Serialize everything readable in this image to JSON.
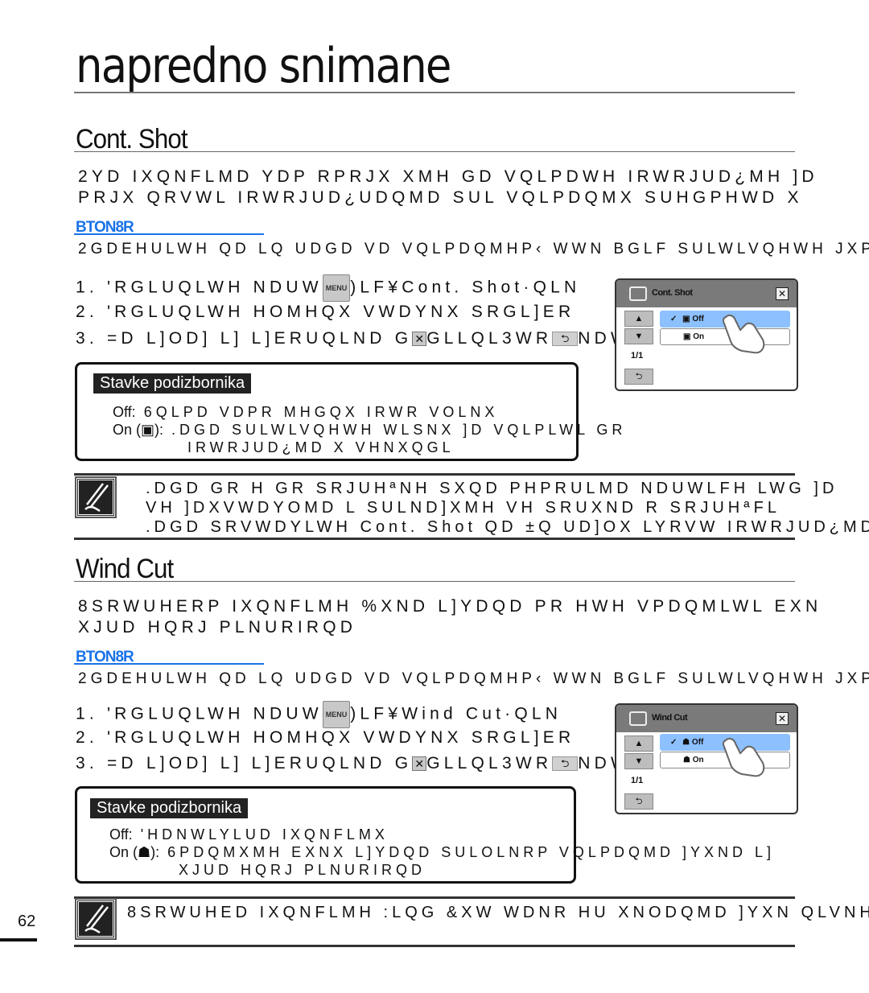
{
  "page": {
    "title": "napredno snimane",
    "number": "62"
  },
  "sections": [
    {
      "heading": "Cont. Shot",
      "intro": [
        "2YD IXQNFLMD YDP RPRJX XMH GD VQLPDWH IRWRJUD¿MH ]D",
        "PRJX QRVWL IRWRJUD¿UDQMD SUL VQLPDQMX SUHGPHWD X"
      ],
      "link_label": "BTON8R",
      "precondition": "2GDEHULWH QD LQ UDGD VD VQLPDQMHP‹ WWN BGLF SULWLVQHWH JXP",
      "steps": [
        {
          "num": "1.",
          "pre": "'RGLUQLWH NDUW",
          "menu_chip": "MENU",
          "post": ")LF¥Cont. Shot·QLN"
        },
        {
          "num": "2.",
          "pre": "'RGLUQLWH  HOMHQX VWDYNX SRGL]ER",
          "menu_chip": "",
          "post": ""
        },
        {
          "num": "3.",
          "pre": "=D L]OD] L] L]ERUQLND G",
          "x_chip": "✕",
          "mid": "GLLQL3WR",
          "back_chip": "⮌",
          "post": "NDW"
        }
      ],
      "screen": {
        "title": "Cont. Shot",
        "page_indicator": "1/1",
        "options": [
          {
            "label": "Off",
            "selected": true,
            "check": "✓"
          },
          {
            "label": "On",
            "selected": false,
            "check": ""
          }
        ],
        "up_label": "▲",
        "down_label": "▼",
        "back_label": "⮌",
        "close_label": "✕"
      },
      "submenu": {
        "title": "Stavke podizbornika",
        "items": [
          {
            "label": "Off:",
            "icon": "",
            "lines": [
              "6QLPD VDPR MHGQX IRWR VOLNX"
            ]
          },
          {
            "label": "On (",
            "icon": "▣",
            "label_end": "):",
            "lines": [
              ".DGD SULWLVQHWH WLSNX ]D VQLPLWL GR",
              "IRWRJUD¿MD X   VHNXQGL"
            ]
          }
        ]
      },
      "note": [
        ".DGD GR H GR SRJUHªNH  SXQD PHPRULMD NDUWLFH  LWG  ]D",
        "VH ]DXVWDYOMD L SULND]XMH VH SRUXND R SRJUHªFL",
        ".DGD SRVWDYLWH Cont. Shot QD ±Q UD]OX LYRVW IRWRJUD¿MD ¿NVLUD VH"
      ]
    },
    {
      "heading": "Wind Cut",
      "intro": [
        "8SRWUHERP IXQNFLMH %XND L]YDQD PR HWH VPDQMLWL EXN",
        "XJUD HQRJ PLNURIRQD"
      ],
      "link_label": "BTON8R",
      "precondition": "2GDEHULWH QD LQ UDGD VD VQLPDQMHP‹ WWN BGLF SULWLVQHWH JXP",
      "steps": [
        {
          "num": "1.",
          "pre": "'RGLUQLWH NDUW",
          "menu_chip": "MENU",
          "post": ")LF¥Wind Cut·QLN"
        },
        {
          "num": "2.",
          "pre": "'RGLUQLWH  HOMHQX VWDYNX SRGL]ER",
          "menu_chip": "",
          "post": ""
        },
        {
          "num": "3.",
          "pre": "=D L]OD] L] L]ERUQLND G",
          "x_chip": "✕",
          "mid": "GLLQL3WR",
          "back_chip": "⮌",
          "post": "NDW"
        }
      ],
      "screen": {
        "title": "Wind Cut",
        "page_indicator": "1/1",
        "options": [
          {
            "label": "Off",
            "selected": true,
            "check": "✓"
          },
          {
            "label": "On",
            "selected": false,
            "check": ""
          }
        ],
        "up_label": "▲",
        "down_label": "▼",
        "back_label": "⮌",
        "close_label": "✕"
      },
      "submenu": {
        "title": "Stavke podizbornika",
        "items": [
          {
            "label": "Off:",
            "icon": "",
            "lines": [
              "'HDNWLYLUD IXQNFLMX"
            ]
          },
          {
            "label": "On (",
            "icon": "☗",
            "label_end": "):",
            "lines": [
              "6PDQMXMH EXNX L]YDQD SULOLNRP VQLPDQMD ]YXND L]",
              "XJUD HQRJ PLNURIRQD"
            ]
          }
        ]
      },
      "note": [
        "8SRWUHED IXQNFLMH :LQG &XW WDNR HU XNODQMD ]YXN QLVNH"
      ]
    }
  ]
}
